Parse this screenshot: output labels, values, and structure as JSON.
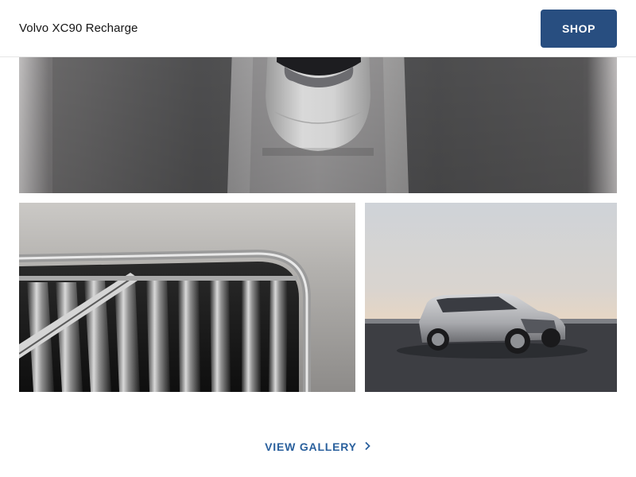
{
  "header": {
    "title": "Volvo XC90 Recharge",
    "shop_label": "SHOP"
  },
  "gallery": {
    "images": [
      {
        "description_name": "car-top-view-image"
      },
      {
        "description_name": "grille-closeup-image"
      },
      {
        "description_name": "suv-side-view-image"
      }
    ],
    "view_gallery_label": "VIEW GALLERY",
    "view_gallery_icon": "chevron-right-icon"
  },
  "colors": {
    "primary_button": "#284e80",
    "link": "#2a609d",
    "text": "#141414"
  }
}
